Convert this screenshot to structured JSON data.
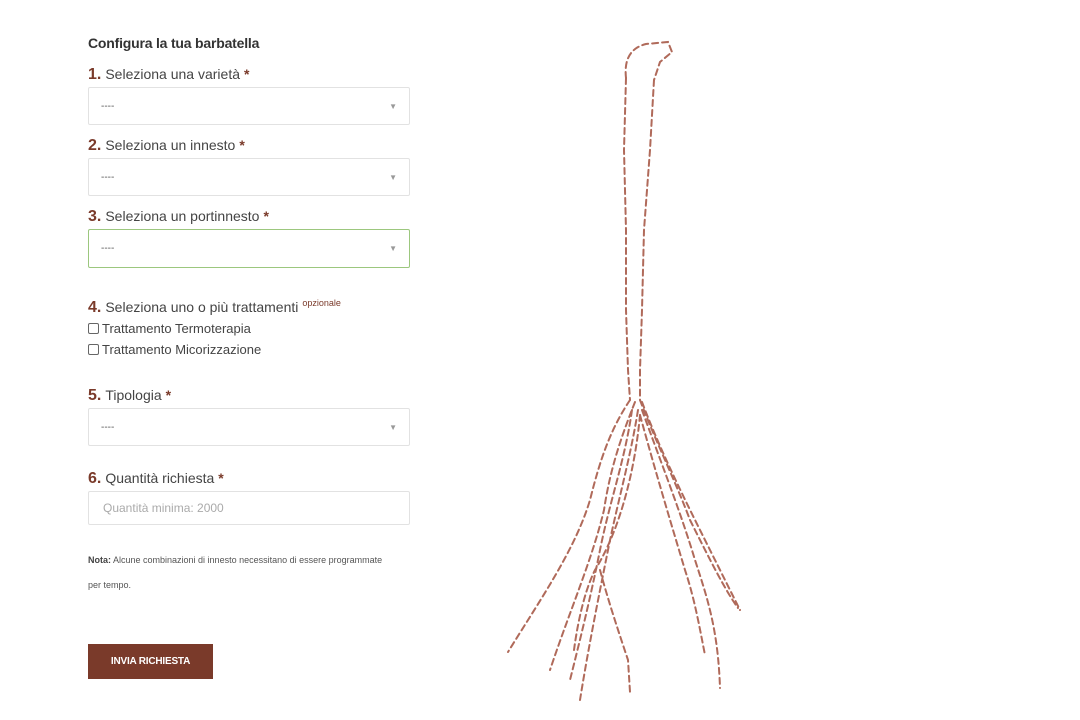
{
  "form": {
    "title": "Configura la tua barbatella",
    "fields": [
      {
        "num": "1.",
        "label": "Seleziona una varietà",
        "required": "*",
        "value": "----"
      },
      {
        "num": "2.",
        "label": "Seleziona un innesto",
        "required": "*",
        "value": "----"
      },
      {
        "num": "3.",
        "label": "Seleziona un portinnesto",
        "required": "*",
        "value": "----"
      },
      {
        "num": "4.",
        "label": "Seleziona uno o più trattamenti",
        "optional": "opzionale",
        "options": [
          "Trattamento Termoterapia",
          "Trattamento Micorizzazione"
        ]
      },
      {
        "num": "5.",
        "label": "Tipologia",
        "required": "*",
        "value": "----"
      },
      {
        "num": "6.",
        "label": "Quantità richiesta",
        "required": "*",
        "placeholder": "Quantità minima: 2000"
      }
    ],
    "note_label": "Nota:",
    "note_text": " Alcune combinazioni di innesto necessitano di essere programmate per tempo.",
    "submit_label": "INVIA RICHIESTA"
  },
  "colors": {
    "accent": "#7a3a2a",
    "focus_border": "#9cc77e",
    "illustration_stroke": "#b06a5a"
  },
  "illustration": {
    "icon": "vine-rootstock-outline"
  }
}
